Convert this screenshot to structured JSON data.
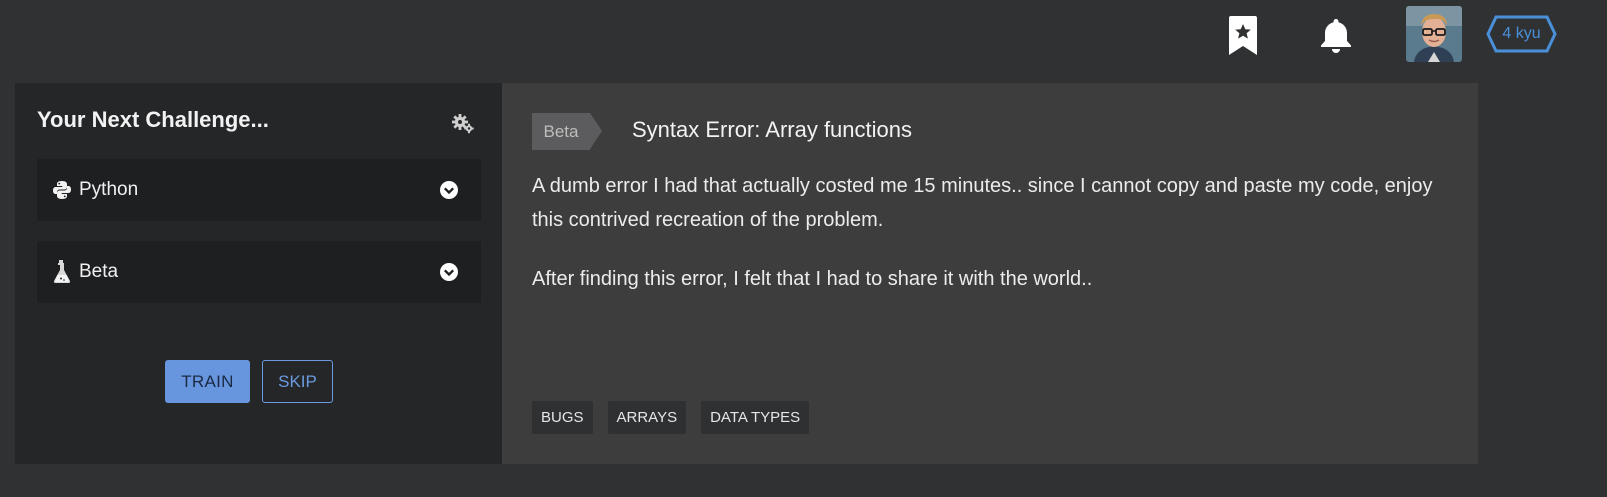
{
  "header": {
    "bookmark_icon": "bookmark-star-icon",
    "notification_icon": "bell-icon",
    "avatar_icon": "user-avatar",
    "rank": "4 kyu",
    "rank_color": "#4a90d9"
  },
  "next_challenge": {
    "title": "Your Next Challenge...",
    "settings_icon": "gear-icon",
    "language": {
      "icon": "python-icon",
      "label": "Python"
    },
    "approach": {
      "icon": "flask-icon",
      "label": "Beta"
    },
    "train_label": "TRAIN",
    "skip_label": "SKIP"
  },
  "kata": {
    "badge": "Beta",
    "title": "Syntax Error: Array functions",
    "description": [
      "A dumb error I had that actually costed me 15 minutes.. since I cannot copy and paste my code, enjoy this contrived recreation of the problem.",
      "After finding this error, I felt that I had to share it with the world.."
    ],
    "tags": [
      "BUGS",
      "ARRAYS",
      "DATA TYPES"
    ]
  },
  "colors": {
    "page_bg": "#303133",
    "left_panel": "#252628",
    "right_panel": "#3d3d3e",
    "accent": "#6795de"
  }
}
